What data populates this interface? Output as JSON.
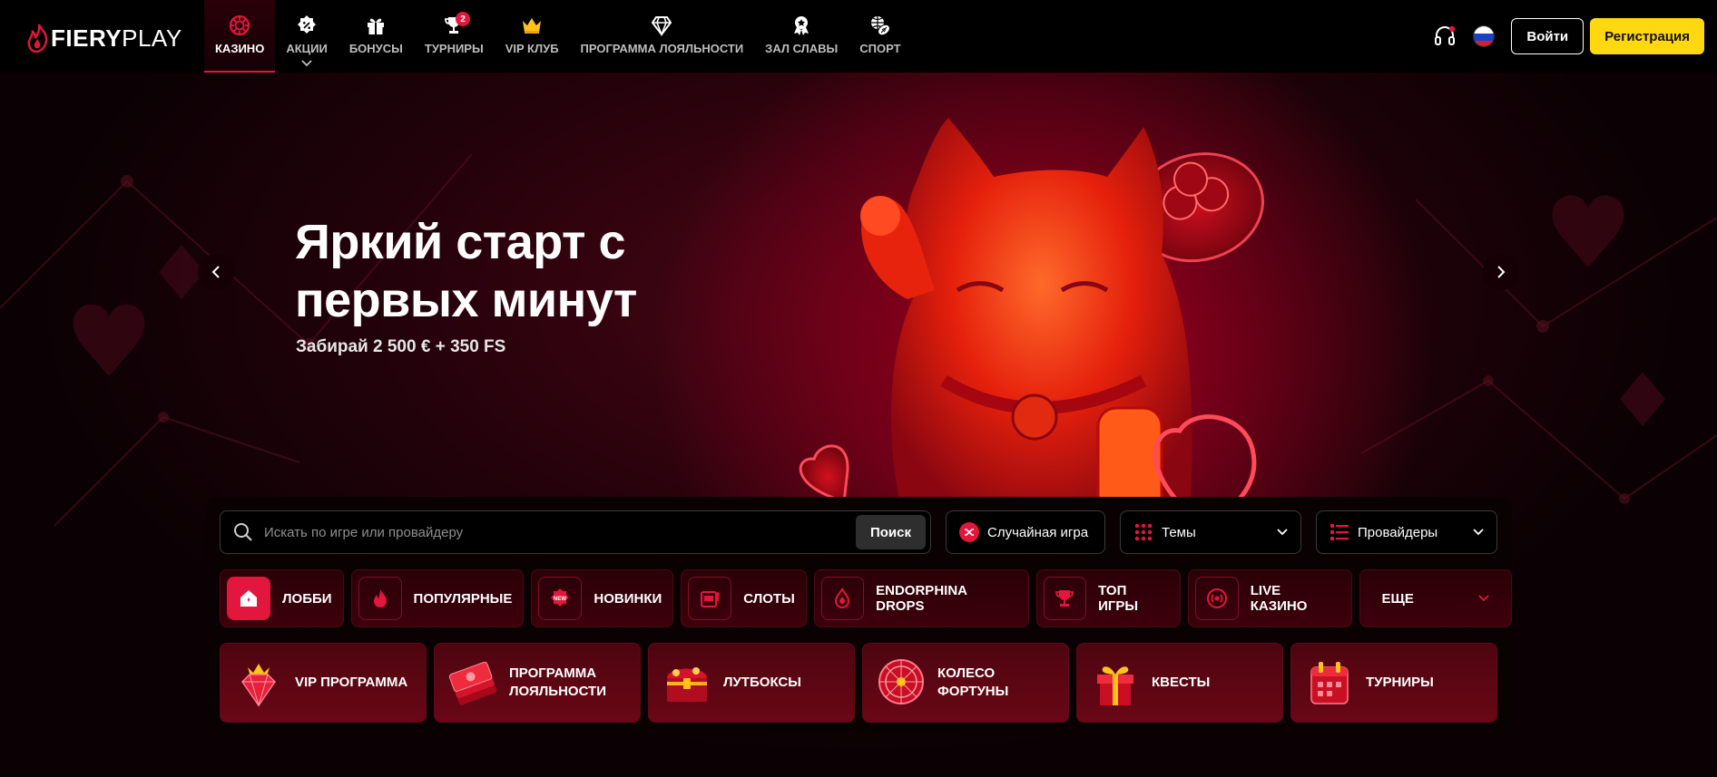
{
  "header": {
    "logo": {
      "bold": "FIERY",
      "light": "PLAY"
    },
    "nav": [
      {
        "label": "КАЗИНО",
        "icon": "casino-chip-icon",
        "active": true
      },
      {
        "label": "АКЦИИ",
        "icon": "promo-badge-icon",
        "has_dropdown": true
      },
      {
        "label": "БОНУСЫ",
        "icon": "gift-icon"
      },
      {
        "label": "ТУРНИРЫ",
        "icon": "trophy-icon",
        "badge": "2"
      },
      {
        "label": "VIP КЛУБ",
        "icon": "crown-icon"
      },
      {
        "label": "ПРОГРАММА ЛОЯЛЬНОСТИ",
        "icon": "diamond-icon"
      },
      {
        "label": "ЗАЛ СЛАВЫ",
        "icon": "medal-icon"
      },
      {
        "label": "СПОРТ",
        "icon": "sport-balls-icon"
      }
    ],
    "login_label": "Войти",
    "register_label": "Регистрация"
  },
  "hero": {
    "title_line1": "Яркий старт с",
    "title_line2": "первых минут",
    "subtitle": "Забирай 2 500 € + 350 FS"
  },
  "search": {
    "placeholder": "Искать по игре или провайдеру",
    "button_label": "Поиск"
  },
  "controls": {
    "random_label": "Случайная игра",
    "themes_label": "Темы",
    "providers_label": "Провайдеры"
  },
  "categories": [
    {
      "label": "ЛОББИ",
      "icon": "home-icon",
      "active": true
    },
    {
      "label": "ПОПУЛЯРНЫЕ",
      "icon": "flame-icon"
    },
    {
      "label": "НОВИНКИ",
      "icon": "new-badge-icon"
    },
    {
      "label": "СЛОТЫ",
      "icon": "slot-machine-icon"
    },
    {
      "label": "ENDORPHINA DROPS",
      "icon": "drop-flame-icon"
    },
    {
      "label": "ТОП ИГРЫ",
      "icon": "top-trophy-icon"
    },
    {
      "label": "LIVE КАЗИНО",
      "icon": "live-broadcast-icon"
    }
  ],
  "more_label": "ЕЩЕ",
  "features": [
    {
      "label_line1": "VIP ПРОГРАММА",
      "label_line2": "",
      "icon": "crowned-gem-icon"
    },
    {
      "label_line1": "ПРОГРАММА",
      "label_line2": "ЛОЯЛЬНОСТИ",
      "icon": "money-stack-icon"
    },
    {
      "label_line1": "ЛУТБОКСЫ",
      "label_line2": "",
      "icon": "treasure-chest-icon"
    },
    {
      "label_line1": "КОЛЕСО",
      "label_line2": "ФОРТУНЫ",
      "icon": "fortune-wheel-icon"
    },
    {
      "label_line1": "КВЕСТЫ",
      "label_line2": "",
      "icon": "gift-box-icon"
    },
    {
      "label_line1": "ТУРНИРЫ",
      "label_line2": "",
      "icon": "calendar-icon"
    }
  ],
  "colors": {
    "accent_red": "#e3163d",
    "register_yellow": "#ffd80f",
    "panel_bg": "#0a0103"
  }
}
